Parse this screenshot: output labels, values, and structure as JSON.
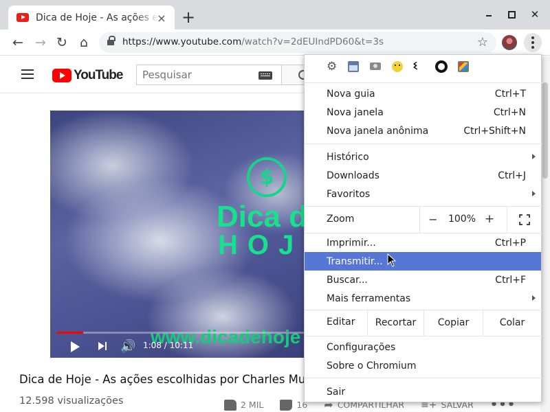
{
  "browser": {
    "tab": {
      "title": "Dica de Hoje - As ações escolhidas por Charles Mungolin"
    },
    "url": {
      "host": "https://www.youtube.com",
      "path": "/watch?v=2dEUIndPD60&t=3s"
    }
  },
  "youtube": {
    "logo_text": "YouTube",
    "search_placeholder": "Pesquisar",
    "player": {
      "dollar_symbol": "$",
      "brand_line1": "Dica de",
      "brand_line2": "HOJE",
      "brand_url": "www.dicadehoje",
      "time_current": "1:08",
      "time_sep": " / ",
      "time_total": "10:11",
      "progress": 0.106
    },
    "video_title": "Dica de Hoje - As ações escolhidas por Charles Mungolin",
    "views": "12.598 visualizações",
    "likes": "2 MIL",
    "dislikes": "16",
    "share_label": "COMPARTILHAR",
    "save_label": "SALVAR"
  },
  "menu": {
    "items": [
      {
        "label": "Nova guia",
        "shortcut": "Ctrl+T"
      },
      {
        "label": "Nova janela",
        "shortcut": "Ctrl+N"
      },
      {
        "label": "Nova janela anônima",
        "shortcut": "Ctrl+Shift+N"
      },
      {
        "label": "Histórico",
        "shortcut": ""
      },
      {
        "label": "Downloads",
        "shortcut": "Ctrl+J"
      },
      {
        "label": "Favoritos",
        "shortcut": ""
      },
      {
        "label": "Imprimir...",
        "shortcut": "Ctrl+P"
      },
      {
        "label": "Transmitir...",
        "shortcut": ""
      },
      {
        "label": "Buscar...",
        "shortcut": "Ctrl+F"
      },
      {
        "label": "Mais ferramentas",
        "shortcut": ""
      },
      {
        "label": "Configurações",
        "shortcut": ""
      },
      {
        "label": "Sobre o Chromium",
        "shortcut": ""
      },
      {
        "label": "Sair",
        "shortcut": ""
      }
    ],
    "zoom": {
      "label": "Zoom",
      "minus": "−",
      "value": "100%",
      "plus": "+"
    },
    "edit": {
      "label": "Editar",
      "cut": "Recortar",
      "copy": "Copiar",
      "paste": "Colar"
    },
    "highlighted": "Transmitir...",
    "highlight_color": "#5677d6"
  },
  "icons": {
    "tab_close": "×",
    "new_tab": "+",
    "back": "←",
    "forward": "→",
    "reload": "↻",
    "home": "⌂",
    "star": "☆",
    "window_close": "✕",
    "volume": "🔊",
    "share": "➦",
    "save": "≡+",
    "more": "•••",
    "ext_gear": "⚙",
    "ext_claw": "ଽ"
  },
  "colors": {
    "youtube_red": "#ff0000",
    "brand_green": "#17e08f",
    "tabstrip": "#dadbdf"
  }
}
